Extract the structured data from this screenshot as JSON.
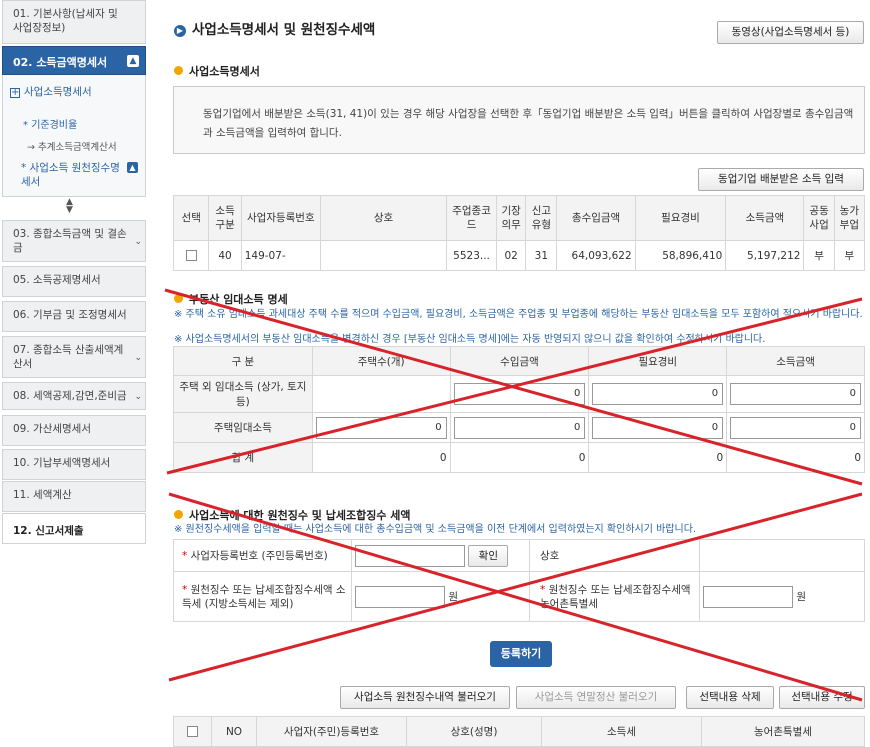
{
  "sidebar": {
    "items": [
      {
        "label": "01. 기본사항(납세자 및 사업장정보)"
      },
      {
        "label": "02. 소득금액명세서"
      },
      {
        "label": "03. 종합소득금액 및 결손금"
      },
      {
        "label": "05. 소득공제명세서"
      },
      {
        "label": "06. 기부금 및 조정명세서"
      },
      {
        "label": "07. 종합소득 산출세액계산서"
      },
      {
        "label": "08. 세액공제,감면,준비금"
      },
      {
        "label": "09. 가산세명세서"
      },
      {
        "label": "10. 기납부세액명세서"
      },
      {
        "label": "11. 세액계산"
      },
      {
        "label": "12. 신고서제출"
      }
    ],
    "sub": {
      "item1": "사업소득명세서",
      "item2": "기준경비율",
      "item3": "추계소득금액계산서",
      "item4": "사업소득 원천징수명세서"
    }
  },
  "main": {
    "title": "사업소득명세서 및 원천징수세액",
    "video_btn": "동영상(사업소득명세서 등)",
    "sec1": "사업소득명세서",
    "info": "동업기업에서 배분받은 소득(31, 41)이 있는 경우 해당 사업장을 선택한 후「동업기업 배분받은 소득 입력」버튼을 클릭하여 사업장별로 총수입금액과 소득금액을 입력하여 합니다.",
    "partner_btn": "동업기업 배분받은 소득 입력",
    "t1": {
      "headers": [
        "선택",
        "소득구분",
        "사업자등록번호",
        "상호",
        "주업종코드",
        "기장의무",
        "신고유형",
        "총수입금액",
        "필요경비",
        "소득금액",
        "공동사업",
        "농가부업"
      ],
      "row": [
        "",
        "40",
        "149-07-",
        "",
        "5523...",
        "02",
        "31",
        "64,093,622",
        "58,896,410",
        "5,197,212",
        "부",
        "부"
      ]
    },
    "sec2": "부동산 임대소득 명세",
    "note2a": "※ 주택 소유 임대소득 과세대상 주택 수를 적으며 수입금액, 필요경비, 소득금액은 주업종 및 부업종에 해당하는 부동산 임대소득을 모두 포함하여 적으시기 바랍니다.",
    "note2b": "※ 사업소득명세서의 부동산 임대소득을 변경하신 경우 [부동산 임대소득 명세]에는 자동 반영되지 않으니 값을 확인하여 수정하시기 바랍니다.",
    "t2": {
      "headers": [
        "구 분",
        "주택수(개)",
        "수입금액",
        "필요경비",
        "소득금액"
      ],
      "row1": "주택 외 임대소득 (상가, 토지 등)",
      "row2": "주택임대소득",
      "row3": "합 계",
      "zero": "0"
    },
    "sec3": "사업소득에 대한 원천징수 및 납세조합징수 세액",
    "note3": "※ 원천징수세액을 입력할 때는 사업소득에 대한 총수입금액 및 소득금액을 이전 단계에서 입력하였는지 확인하시기 바랍니다.",
    "t3": {
      "bizno_label": "사업자등록번호 (주민등록번호)",
      "confirm_btn": "확인",
      "company_label": "상호",
      "tax_label": "원천징수 또는 납세조합징수세액 소득세 (지방소득세는 제외)",
      "won": "원",
      "farm_label": "원천징수 또는 납세조합징수세액 농어촌특별세"
    },
    "register_btn": "등록하기",
    "load_btn": "사업소득 원천징수내역 불러오기",
    "load_year_btn": "사업소득 연말정산 불러오기",
    "delete_btn": "선택내용 삭제",
    "edit_btn": "선택내용 수정",
    "t4": {
      "headers": [
        "",
        "NO",
        "사업자(주민)등록번호",
        "상호(성명)",
        "소득세",
        "농어촌특별세"
      ]
    }
  }
}
